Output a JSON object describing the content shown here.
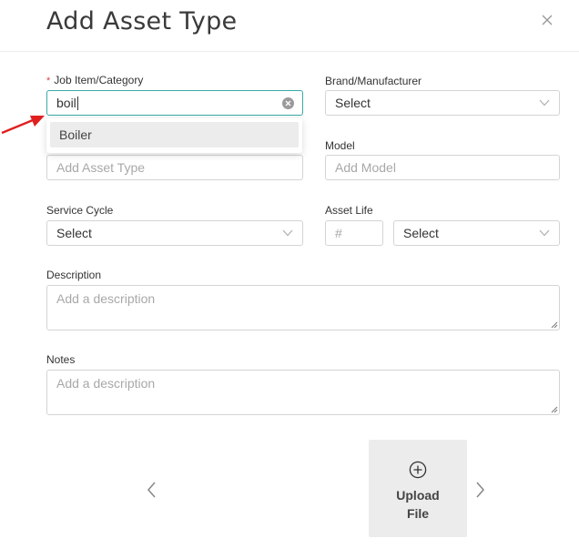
{
  "dialog": {
    "title": "Add Asset Type"
  },
  "fields": {
    "job_item": {
      "label": "Job Item/Category",
      "value": "boil"
    },
    "brand": {
      "label": "Brand/Manufacturer",
      "value": "Select"
    },
    "asset_type": {
      "placeholder": "Add Asset Type"
    },
    "model": {
      "label": "Model",
      "placeholder": "Add Model"
    },
    "service_cycle": {
      "label": "Service Cycle",
      "value": "Select"
    },
    "asset_life": {
      "label": "Asset Life",
      "number_placeholder": "#",
      "unit_value": "Select"
    },
    "description": {
      "label": "Description",
      "placeholder": "Add a description"
    },
    "notes": {
      "label": "Notes",
      "placeholder": "Add a description"
    }
  },
  "dropdown": {
    "options": [
      "Boiler"
    ]
  },
  "upload": {
    "label": "Upload File"
  },
  "colors": {
    "accent": "#3aa9a6",
    "arrow": "#e02020",
    "required": "#d64545"
  },
  "icons": {
    "close": "close-icon",
    "clear": "clear-icon",
    "chevron": "chevron-down-icon",
    "upload": "plus-circle-icon",
    "prev": "chevron-left-icon",
    "next": "chevron-right-icon",
    "annotation": "red-arrow-icon"
  }
}
